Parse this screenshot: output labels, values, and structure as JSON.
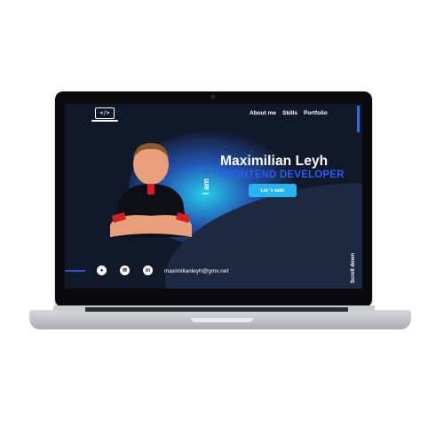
{
  "nav": {
    "logo_text": "</>",
    "links": [
      "About me",
      "Skills",
      "Portfolio"
    ]
  },
  "hero": {
    "intro": "I am",
    "name": "Maximilian Leyh",
    "role": "FRONTEND DEVELOPER",
    "cta_label": "Let 's talk!"
  },
  "footer": {
    "socials": [
      {
        "name": "github",
        "glyph": "●"
      },
      {
        "name": "mail",
        "glyph": "✉"
      },
      {
        "name": "linkedin",
        "glyph": "in"
      }
    ],
    "email": "maximilianleyh@gmx.net",
    "scroll_label": "Scroll down"
  },
  "colors": {
    "background": "#11182a",
    "accent_blue": "#2a5df2",
    "cta": "#27b5f0"
  }
}
